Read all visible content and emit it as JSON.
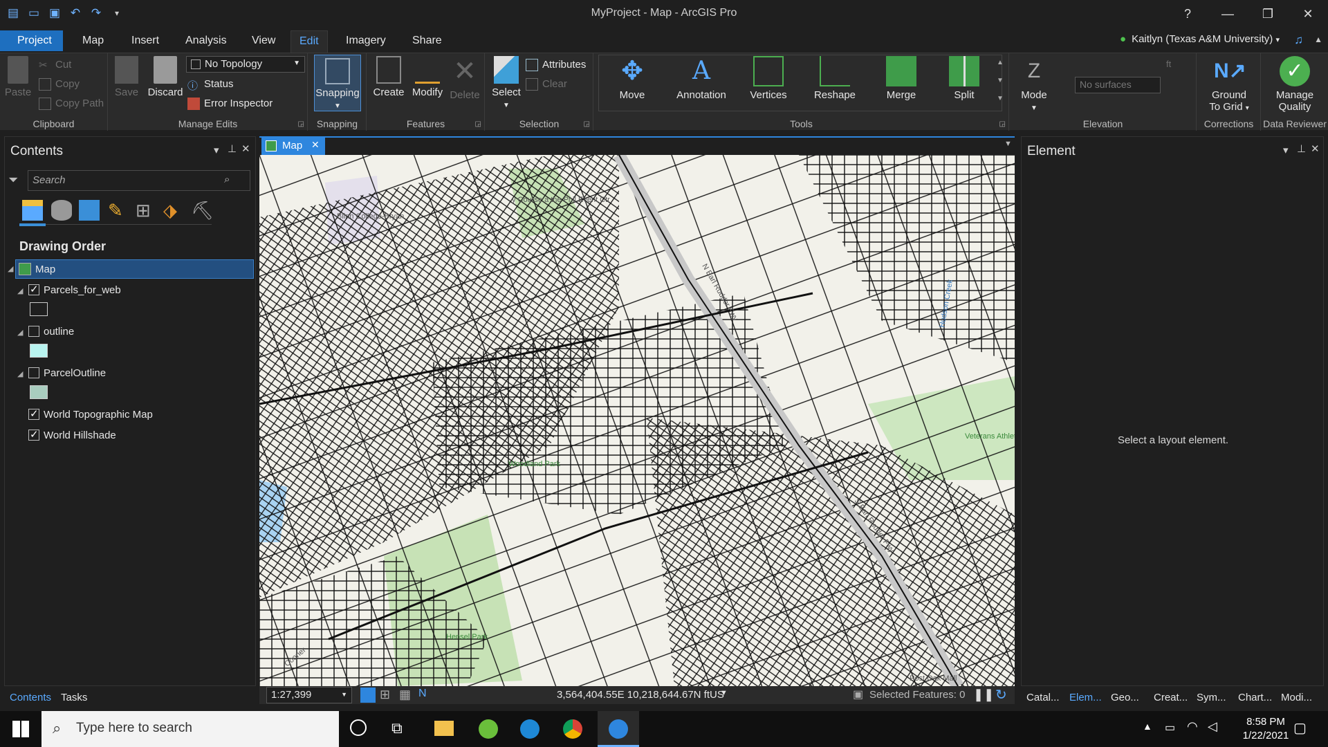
{
  "window": {
    "title": "MyProject - Map - ArcGIS Pro",
    "help": "?",
    "minimize": "—",
    "restore": "❐",
    "close": "✕"
  },
  "ribbon_tabs": [
    "Project",
    "Map",
    "Insert",
    "Analysis",
    "View",
    "Edit",
    "Imagery",
    "Share"
  ],
  "active_tab": "Edit",
  "user": "Kaitlyn (Texas A&M University)",
  "ribbon": {
    "clipboard": {
      "paste": "Paste",
      "cut": "Cut",
      "copy": "Copy",
      "copy_path": "Copy Path",
      "label": "Clipboard"
    },
    "manage_edits": {
      "save": "Save",
      "discard": "Discard",
      "topology": "No Topology",
      "status": "Status",
      "error_inspector": "Error Inspector",
      "label": "Manage Edits"
    },
    "snapping": {
      "button": "Snapping",
      "label": "Snapping"
    },
    "features": {
      "create": "Create",
      "modify": "Modify",
      "delete": "Delete",
      "label": "Features"
    },
    "selection": {
      "select": "Select",
      "attributes": "Attributes",
      "clear": "Clear",
      "label": "Selection"
    },
    "tools": {
      "move": "Move",
      "annotation": "Annotation",
      "vertices": "Vertices",
      "reshape": "Reshape",
      "merge": "Merge",
      "split": "Split",
      "label": "Tools"
    },
    "elevation": {
      "mode": "Mode",
      "surfaces_placeholder": "No surfaces",
      "unit": "ft",
      "label": "Elevation"
    },
    "corrections": {
      "ground_line1": "Ground",
      "ground_line2": "To Grid",
      "label": "Corrections"
    },
    "data_reviewer": {
      "manage_line1": "Manage",
      "manage_line2": "Quality",
      "label": "Data Reviewer"
    }
  },
  "contents": {
    "title": "Contents",
    "search_placeholder": "Search",
    "drawing_order": "Drawing Order",
    "layers": [
      {
        "name": "Map",
        "selected": true
      },
      {
        "name": "Parcels_for_web",
        "checked": true,
        "swatch": "#1f1f1f"
      },
      {
        "name": "outline",
        "checked": false,
        "swatch": "#b8f3ef"
      },
      {
        "name": "ParcelOutline",
        "checked": false,
        "swatch": "#a9cdbf"
      },
      {
        "name": "World Topographic Map",
        "checked": true
      },
      {
        "name": "World Hillshade",
        "checked": true
      }
    ],
    "bottom_tabs": [
      "Contents",
      "Tasks"
    ]
  },
  "map_view": {
    "tab": "Map",
    "labels": [
      "Blinn College-Bryan",
      "y Course a the Phil Event Ctr",
      "N Earl Rudder Fwy",
      "S Earl Rudder Fwy",
      "Hudson Creek",
      "Veterans Athletic Par",
      "Hensel Park",
      "Post Oak Mall",
      "Woodland Park",
      "Cooner"
    ],
    "scale": "1:27,399",
    "coordinates": "3,564,404.55E 10,218,644.67N ftUS",
    "selected_features": "Selected Features: 0"
  },
  "element_pane": {
    "title": "Element",
    "message": "Select a layout element.",
    "bottom_tabs": [
      "Catal...",
      "Elem...",
      "Geo...",
      "Creat...",
      "Sym...",
      "Chart...",
      "Modi..."
    ]
  },
  "taskbar": {
    "search_placeholder": "Type here to search",
    "time": "8:58 PM",
    "date": "1/22/2021"
  },
  "colors": {
    "accent": "#1e6fbf",
    "active_tab_text": "#5aaaff",
    "map_bg": "#f2f1ea",
    "park": "#c7e2b6"
  }
}
